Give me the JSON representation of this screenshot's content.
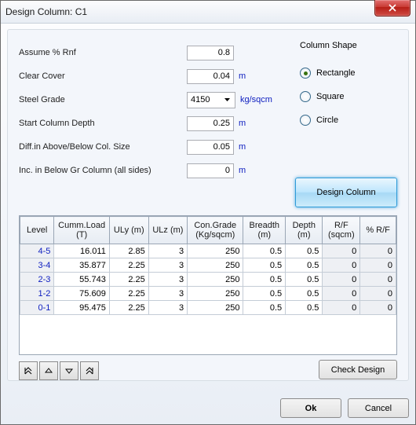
{
  "window": {
    "title": "Design Column: C1"
  },
  "form": {
    "assume_label": "Assume % Rnf",
    "assume_value": "0.8",
    "clear_label": "Clear Cover",
    "clear_value": "0.04",
    "clear_unit": "m",
    "steel_label": "Steel Grade",
    "steel_value": "4150",
    "steel_unit": "kg/sqcm",
    "start_label": "Start Column Depth",
    "start_value": "0.25",
    "start_unit": "m",
    "diff_label": "Diff.in Above/Below Col. Size",
    "diff_value": "0.05",
    "diff_unit": "m",
    "inc_label": "Inc. in Below Gr Column (all sides)",
    "inc_value": "0",
    "inc_unit": "m"
  },
  "shape": {
    "title": "Column Shape",
    "rectangle": "Rectangle",
    "square": "Square",
    "circle": "Circle",
    "selected": "rectangle"
  },
  "buttons": {
    "design": "Design Column",
    "check": "Check Design",
    "ok": "Ok",
    "cancel": "Cancel"
  },
  "grid": {
    "headers": {
      "level": "Level",
      "cumm": "Cumm.Load (T)",
      "uly": "ULy (m)",
      "ulz": "ULz (m)",
      "con": "Con.Grade (Kg/sqcm)",
      "breadth": "Breadth (m)",
      "depth": "Depth (m)",
      "rf": "R/F (sqcm)",
      "prf": "% R/F"
    },
    "rows": [
      {
        "level": "4-5",
        "cumm": "16.011",
        "uly": "2.85",
        "ulz": "3",
        "con": "250",
        "breadth": "0.5",
        "depth": "0.5",
        "rf": "0",
        "prf": "0"
      },
      {
        "level": "3-4",
        "cumm": "35.877",
        "uly": "2.25",
        "ulz": "3",
        "con": "250",
        "breadth": "0.5",
        "depth": "0.5",
        "rf": "0",
        "prf": "0"
      },
      {
        "level": "2-3",
        "cumm": "55.743",
        "uly": "2.25",
        "ulz": "3",
        "con": "250",
        "breadth": "0.5",
        "depth": "0.5",
        "rf": "0",
        "prf": "0"
      },
      {
        "level": "1-2",
        "cumm": "75.609",
        "uly": "2.25",
        "ulz": "3",
        "con": "250",
        "breadth": "0.5",
        "depth": "0.5",
        "rf": "0",
        "prf": "0"
      },
      {
        "level": "0-1",
        "cumm": "95.475",
        "uly": "2.25",
        "ulz": "3",
        "con": "250",
        "breadth": "0.5",
        "depth": "0.5",
        "rf": "0",
        "prf": "0"
      }
    ]
  }
}
